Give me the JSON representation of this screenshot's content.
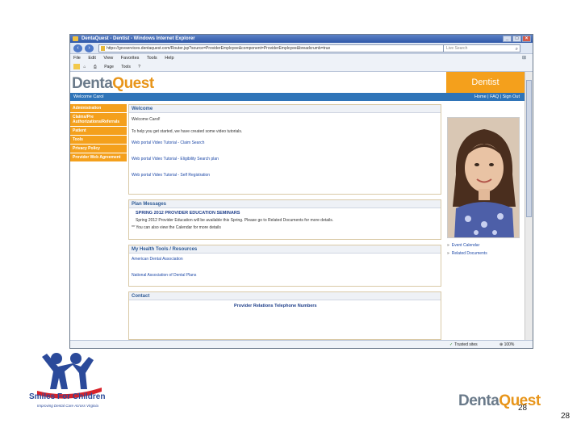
{
  "browser": {
    "title": "DentaQuest - Dentist - Windows Internet Explorer",
    "url": "https://govservices.dentaquest.com/Router.jsp?source=ProviderEmployee&component=ProviderEmployee&breadcrumb=true",
    "search_placeholder": "Live Search",
    "menu": [
      "File",
      "Edit",
      "View",
      "Favorites",
      "Tools",
      "Help"
    ],
    "commands": [
      "Page",
      "Tools"
    ],
    "status_trusted": "Trusted sites",
    "zoom": "100%"
  },
  "site": {
    "logo_a": "Denta",
    "logo_b": "Quest",
    "role_banner": "Dentist",
    "welcome_bar": "Welcome Carol",
    "account_links": "Home | FAQ | Sign Out"
  },
  "sidenav": [
    "Administration",
    "Claims/Pre Authorizations/Referrals",
    "Patient",
    "Tools",
    "Privacy Policy",
    "Provider Web Agreement"
  ],
  "welcome": {
    "header": "Welcome",
    "greeting": "Welcome Carol!",
    "intro": "To help you get started, we have created some video tutorials.",
    "links": [
      "Web portal Video Tutorial - Claim Search",
      "Web portal Video Tutorial - Eligibility Search plan",
      "Web portal Video Tutorial - Self Registration"
    ]
  },
  "plan_messages": {
    "header": "Plan Messages",
    "title": "SPRING 2012 PROVIDER EDUCATION SEMINARS",
    "body": "Spring 2012 Provider Education will be available this Spring. Please go to Related Documents for more details.",
    "note": "** You can also view the Calendar for more details"
  },
  "tools": {
    "header": "My Health Tools / Resources",
    "links": [
      "American Dental Association",
      "National Association of Dental Plans"
    ]
  },
  "contact": {
    "header": "Contact",
    "title": "Provider Relations Telephone Numbers"
  },
  "side_links": [
    "Event Calendar",
    "Related Documents"
  ],
  "slide": {
    "smiles_title": "Smiles For Children",
    "smiles_tagline": "Improving Dental Care Across Virginia",
    "footer_logo_a": "Denta",
    "footer_logo_b": "Quest",
    "page_number_1": "28",
    "page_number_2": "28"
  }
}
